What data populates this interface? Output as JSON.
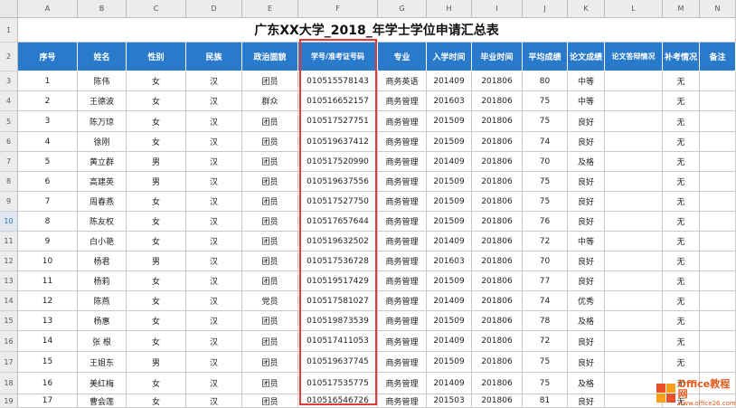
{
  "columns": [
    "A",
    "B",
    "C",
    "D",
    "E",
    "F",
    "G",
    "H",
    "I",
    "J",
    "K",
    "L",
    "M",
    "N"
  ],
  "row_numbers": [
    "1",
    "2",
    "3",
    "4",
    "5",
    "6",
    "7",
    "8",
    "9",
    "10",
    "11",
    "12",
    "13",
    "14",
    "15",
    "16",
    "17",
    "18",
    "19"
  ],
  "selected_row": "10",
  "title": "广东XX大学_2018_年学士学位申请汇总表",
  "headers": [
    "序号",
    "姓名",
    "性别",
    "民族",
    "政治面貌",
    "学号/准考证号码",
    "专业",
    "入学时间",
    "毕业时间",
    "平均成绩",
    "论文成绩",
    "论文答辩情况",
    "补考情况",
    "备注"
  ],
  "rows": [
    [
      "1",
      "陈伟",
      "女",
      "汉",
      "团员",
      "010515578143",
      "商务英语",
      "201409",
      "201806",
      "80",
      "中等",
      "",
      "无",
      ""
    ],
    [
      "2",
      "王德波",
      "女",
      "汉",
      "群众",
      "010516652157",
      "商务管理",
      "201603",
      "201806",
      "75",
      "中等",
      "",
      "无",
      ""
    ],
    [
      "3",
      "陈万琼",
      "女",
      "汉",
      "团员",
      "010517527751",
      "商务管理",
      "201509",
      "201806",
      "75",
      "良好",
      "",
      "无",
      ""
    ],
    [
      "4",
      "徐刚",
      "女",
      "汉",
      "团员",
      "010519637412",
      "商务管理",
      "201509",
      "201806",
      "74",
      "良好",
      "",
      "无",
      ""
    ],
    [
      "5",
      "黄立群",
      "男",
      "汉",
      "团员",
      "010517520990",
      "商务管理",
      "201409",
      "201806",
      "70",
      "及格",
      "",
      "无",
      ""
    ],
    [
      "6",
      "高建英",
      "男",
      "汉",
      "团员",
      "010519637556",
      "商务管理",
      "201509",
      "201806",
      "75",
      "良好",
      "",
      "无",
      ""
    ],
    [
      "7",
      "周春燕",
      "女",
      "汉",
      "团员",
      "010517527750",
      "商务管理",
      "201509",
      "201806",
      "75",
      "良好",
      "",
      "无",
      ""
    ],
    [
      "8",
      "陈友权",
      "女",
      "汉",
      "团员",
      "010517657644",
      "商务管理",
      "201509",
      "201806",
      "76",
      "良好",
      "",
      "无",
      ""
    ],
    [
      "9",
      "白小艳",
      "女",
      "汉",
      "团员",
      "010519632502",
      "商务管理",
      "201409",
      "201806",
      "72",
      "中等",
      "",
      "无",
      ""
    ],
    [
      "10",
      "杨君",
      "男",
      "汉",
      "团员",
      "010517536728",
      "商务管理",
      "201603",
      "201806",
      "70",
      "良好",
      "",
      "无",
      ""
    ],
    [
      "11",
      "杨莉",
      "女",
      "汉",
      "团员",
      "010519517429",
      "商务管理",
      "201509",
      "201806",
      "77",
      "良好",
      "",
      "无",
      ""
    ],
    [
      "12",
      "陈燕",
      "女",
      "汉",
      "党员",
      "010517581027",
      "商务管理",
      "201409",
      "201806",
      "74",
      "优秀",
      "",
      "无",
      ""
    ],
    [
      "13",
      "杨惠",
      "女",
      "汉",
      "团员",
      "010519873539",
      "商务管理",
      "201509",
      "201806",
      "78",
      "及格",
      "",
      "无",
      ""
    ],
    [
      "14",
      "张 根",
      "女",
      "汉",
      "团员",
      "010517411053",
      "商务管理",
      "201409",
      "201806",
      "72",
      "良好",
      "",
      "无",
      ""
    ],
    [
      "15",
      "王姐东",
      "男",
      "汉",
      "团员",
      "010519637745",
      "商务管理",
      "201509",
      "201806",
      "75",
      "良好",
      "",
      "无",
      ""
    ],
    [
      "16",
      "美红梅",
      "女",
      "汉",
      "团员",
      "010517535775",
      "商务管理",
      "201409",
      "201806",
      "75",
      "及格",
      "",
      "无",
      ""
    ],
    [
      "17",
      "曹会莲",
      "女",
      "汉",
      "团员",
      "010516546726",
      "商务管理",
      "201503",
      "201806",
      "81",
      "良好",
      "",
      "无",
      ""
    ]
  ],
  "watermark": {
    "brand": "Office教程网",
    "url": "www.office26.com"
  },
  "colors": {
    "header_bg": "#2a7acb",
    "highlight": "#e23a3a",
    "watermark": "#e05a1c"
  }
}
